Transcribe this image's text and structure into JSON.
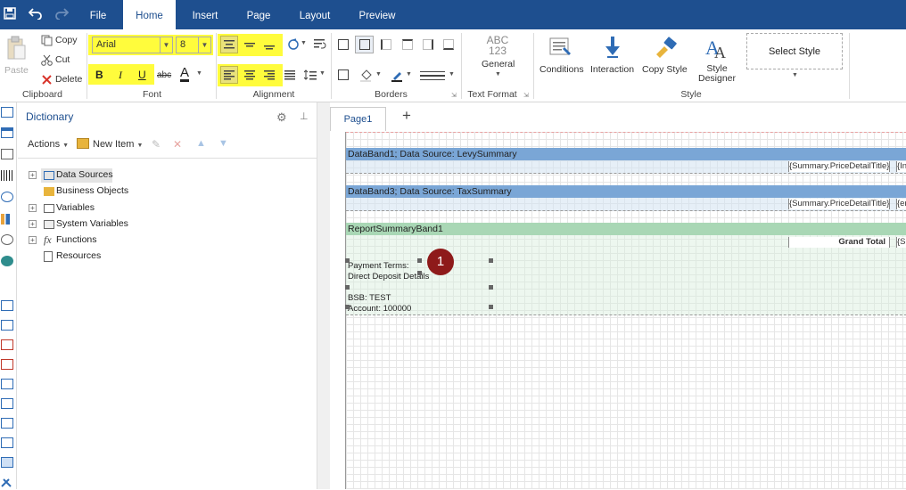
{
  "quick_access": {
    "save_icon": "save-icon",
    "undo_icon": "undo-icon",
    "redo_icon": "redo-icon"
  },
  "tabs": [
    {
      "label": "File"
    },
    {
      "label": "Home"
    },
    {
      "label": "Insert"
    },
    {
      "label": "Page"
    },
    {
      "label": "Layout"
    },
    {
      "label": "Preview"
    }
  ],
  "ribbon": {
    "clipboard": {
      "paste": "Paste",
      "copy": "Copy",
      "cut": "Cut",
      "delete": "Delete",
      "label": "Clipboard"
    },
    "font": {
      "family": "Arial",
      "size": "8",
      "bold": "B",
      "italic": "I",
      "underline": "U",
      "strike": "abc",
      "color": "A",
      "label": "Font"
    },
    "alignment": {
      "label": "Alignment"
    },
    "borders": {
      "label": "Borders"
    },
    "text_format": {
      "preview_line1": "ABC",
      "preview_line2": "123",
      "general": "General",
      "label": "Text Format"
    },
    "style": {
      "conditions": "Conditions",
      "interaction": "Interaction",
      "copy_style": "Copy Style",
      "style_designer_line1": "Style",
      "style_designer_line2": "Designer",
      "select_style": "Select Style",
      "label": "Style"
    }
  },
  "dictionary": {
    "title": "Dictionary",
    "actions": "Actions",
    "new_item": "New Item",
    "tree": [
      {
        "label": "Data Sources",
        "expandable": true
      },
      {
        "label": "Business Objects",
        "expandable": false
      },
      {
        "label": "Variables",
        "expandable": true
      },
      {
        "label": "System Variables",
        "expandable": true
      },
      {
        "label": "Functions",
        "expandable": true
      },
      {
        "label": "Resources",
        "expandable": false
      }
    ]
  },
  "page_tab": {
    "label": "Page1",
    "add": "+"
  },
  "bands": [
    {
      "title": "DataBand1; Data Source: LevySummary",
      "field1": "{Summary.PriceDetailTitle}",
      "field2": "{Inc"
    },
    {
      "title": "DataBand3; Data Source: TaxSummary",
      "field1": "{Summary.PriceDetailTitle}",
      "field2": "{en"
    },
    {
      "title": "ReportSummaryBand1",
      "field1": "Grand Total",
      "field2": "{Sic"
    }
  ],
  "text_block": {
    "line1": "Payment Terms:",
    "line2": "Direct Deposit Details",
    "line3": "BSB: TEST",
    "line4": "Account: 100000"
  },
  "marker": "1",
  "colors": {
    "accent": "#1e4f8f",
    "highlight": "#fffc3c",
    "databand": "#7aa6d6",
    "summaryband": "#a9d7b5",
    "marker": "#8e1a1a"
  }
}
